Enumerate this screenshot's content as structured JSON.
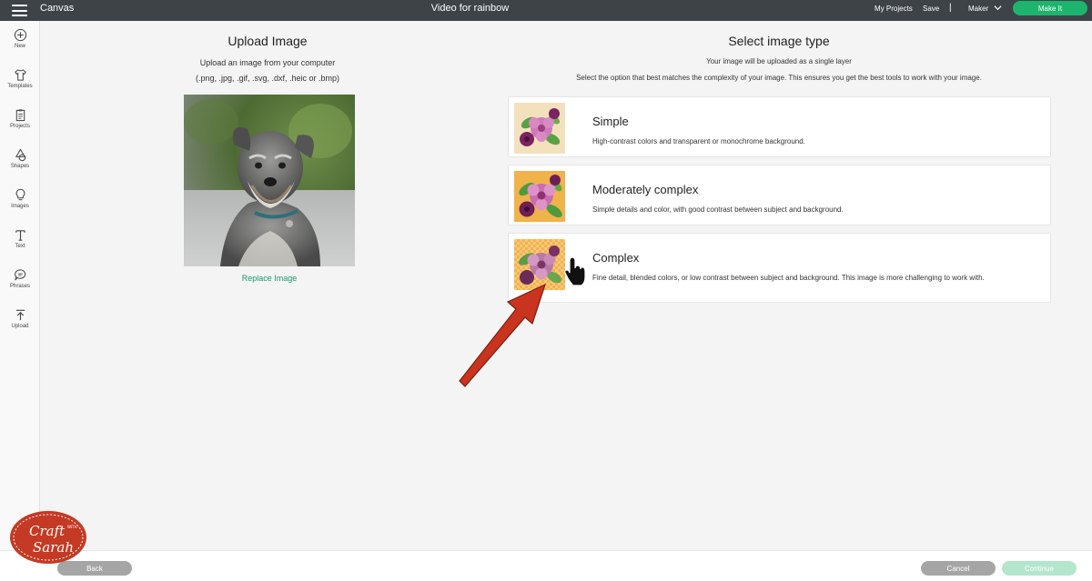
{
  "topbar": {
    "app_name": "Canvas",
    "document_title": "Video for rainbow",
    "my_projects": "My Projects",
    "save": "Save",
    "separator": "|",
    "machine": "Maker",
    "make_it": "Make It"
  },
  "sidebar": {
    "items": [
      {
        "label": "New",
        "icon": "plus-circle-icon"
      },
      {
        "label": "Templates",
        "icon": "shirt-icon"
      },
      {
        "label": "Projects",
        "icon": "clipboard-icon"
      },
      {
        "label": "Shapes",
        "icon": "shapes-icon"
      },
      {
        "label": "Images",
        "icon": "lightbulb-icon"
      },
      {
        "label": "Text",
        "icon": "text-icon"
      },
      {
        "label": "Phrases",
        "icon": "speech-bubble-icon"
      },
      {
        "label": "Upload",
        "icon": "upload-icon"
      }
    ]
  },
  "upload": {
    "title": "Upload Image",
    "subtitle_line1": "Upload an image from your computer",
    "subtitle_line2": "(.png, .jpg, .gif, .svg, .dxf, .heic or .bmp)",
    "replace_link": "Replace Image"
  },
  "select": {
    "title": "Select image type",
    "subtitle_line1": "Your image will be uploaded as a single layer",
    "subtitle_line2": "Select the option that best matches the complexity of your image. This ensures you get the best tools to work with your image.",
    "options": [
      {
        "title": "Simple",
        "description": "High-contrast colors and transparent or monochrome background."
      },
      {
        "title": "Moderately complex",
        "description": "Simple details and color, with good contrast between subject and background."
      },
      {
        "title": "Complex",
        "description": "Fine detail, blended colors, or low contrast between subject and background. This image is more challenging to work with."
      }
    ]
  },
  "bottom": {
    "back": "Back",
    "cancel": "Cancel",
    "continue": "Continue"
  },
  "colors": {
    "topbar_bg": "#3d4347",
    "accent_green": "#1db56e",
    "link_green": "#1b9a6c",
    "arrow_red": "#c8341e",
    "logo_red": "#c43a24"
  }
}
